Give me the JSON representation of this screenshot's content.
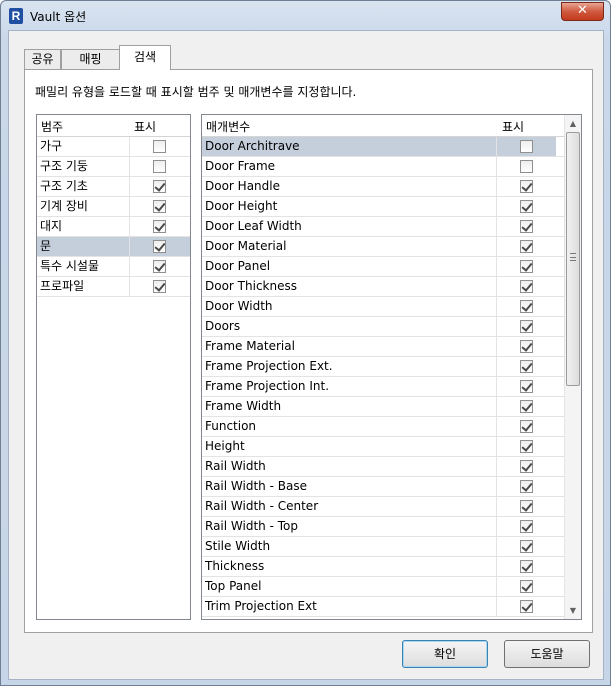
{
  "window": {
    "title": "Vault 옵션",
    "close_glyph": "✕"
  },
  "tabs": [
    {
      "label": "공유"
    },
    {
      "label": "매핑"
    },
    {
      "label": "검색"
    }
  ],
  "instruction": "패밀리 유형을 로드할 때 표시할 범주 및 매개변수를 지정합니다.",
  "categories": {
    "header_name": "범주",
    "header_show": "표시",
    "rows": [
      {
        "name": "가구",
        "checked": false,
        "selected": false
      },
      {
        "name": "구조 기둥",
        "checked": false,
        "selected": false
      },
      {
        "name": "구조 기초",
        "checked": true,
        "selected": false
      },
      {
        "name": "기계 장비",
        "checked": true,
        "selected": false
      },
      {
        "name": "대지",
        "checked": true,
        "selected": false
      },
      {
        "name": "문",
        "checked": true,
        "selected": true
      },
      {
        "name": "특수 시설물",
        "checked": true,
        "selected": false
      },
      {
        "name": "프로파일",
        "checked": true,
        "selected": false
      }
    ]
  },
  "parameters": {
    "header_name": "매개변수",
    "header_show": "표시",
    "rows": [
      {
        "name": "Door Architrave",
        "checked": false,
        "selected": true
      },
      {
        "name": "Door Frame",
        "checked": false,
        "selected": false
      },
      {
        "name": "Door Handle",
        "checked": true,
        "selected": false
      },
      {
        "name": "Door Height",
        "checked": true,
        "selected": false
      },
      {
        "name": "Door Leaf Width",
        "checked": true,
        "selected": false
      },
      {
        "name": "Door Material",
        "checked": true,
        "selected": false
      },
      {
        "name": "Door Panel",
        "checked": true,
        "selected": false
      },
      {
        "name": "Door Thickness",
        "checked": true,
        "selected": false
      },
      {
        "name": "Door Width",
        "checked": true,
        "selected": false
      },
      {
        "name": "Doors",
        "checked": true,
        "selected": false
      },
      {
        "name": "Frame Material",
        "checked": true,
        "selected": false
      },
      {
        "name": "Frame Projection Ext.",
        "checked": true,
        "selected": false
      },
      {
        "name": "Frame Projection Int.",
        "checked": true,
        "selected": false
      },
      {
        "name": "Frame Width",
        "checked": true,
        "selected": false
      },
      {
        "name": "Function",
        "checked": true,
        "selected": false
      },
      {
        "name": "Height",
        "checked": true,
        "selected": false
      },
      {
        "name": "Rail Width",
        "checked": true,
        "selected": false
      },
      {
        "name": "Rail Width - Base",
        "checked": true,
        "selected": false
      },
      {
        "name": "Rail Width - Center",
        "checked": true,
        "selected": false
      },
      {
        "name": "Rail Width - Top",
        "checked": true,
        "selected": false
      },
      {
        "name": "Stile Width",
        "checked": true,
        "selected": false
      },
      {
        "name": "Thickness",
        "checked": true,
        "selected": false
      },
      {
        "name": "Top Panel",
        "checked": true,
        "selected": false
      },
      {
        "name": "Trim Projection Ext",
        "checked": true,
        "selected": false
      }
    ]
  },
  "scrollbar": {
    "up_glyph": "▲",
    "down_glyph": "▼",
    "position": 0.0
  },
  "buttons": {
    "ok": "확인",
    "help": "도움말"
  },
  "colors": {
    "selection": "#c5cedb",
    "title_gradient": "#d9e4f1",
    "close_button": "#c3391c"
  }
}
